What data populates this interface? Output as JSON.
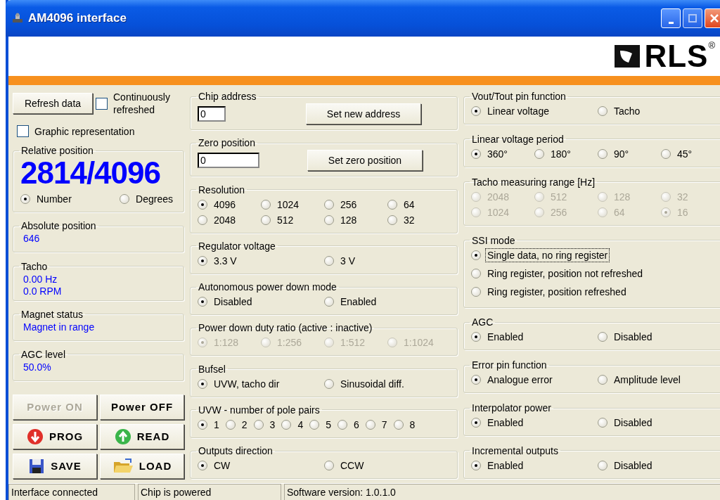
{
  "window": {
    "title": "AM4096 interface"
  },
  "logo": {
    "text": "RLS$^{®}$"
  },
  "left": {
    "refresh_button": "Refresh data",
    "continuous": {
      "label": "Continuously refreshed",
      "checked": false
    },
    "graphic": {
      "label": "Graphic representation",
      "checked": false
    },
    "relative": {
      "title": "Relative position",
      "value": "2814/4096",
      "options": [
        {
          "label": "Number",
          "selected": true
        },
        {
          "label": "Degrees",
          "selected": false
        }
      ]
    },
    "info": [
      {
        "title": "Absolute position",
        "lines": [
          "646"
        ]
      },
      {
        "title": "Tacho",
        "lines": [
          "0.00 Hz",
          "0.0 RPM"
        ]
      },
      {
        "title": "Magnet status",
        "lines": [
          "Magnet in range"
        ]
      },
      {
        "title": "AGC level",
        "lines": [
          "50.0%"
        ]
      }
    ],
    "buttons": [
      {
        "label": "Power ON",
        "disabled": true
      },
      {
        "label": "Power OFF",
        "disabled": false
      },
      {
        "label": "PROG",
        "disabled": false
      },
      {
        "label": "READ",
        "disabled": false
      },
      {
        "label": "SAVE",
        "disabled": false
      },
      {
        "label": "LOAD",
        "disabled": false
      }
    ]
  },
  "middle": [
    {
      "kind": "field",
      "title": "Chip address",
      "value": "0",
      "button": "Set new address",
      "disabled": false
    },
    {
      "kind": "field",
      "title": "Zero position",
      "value": "0",
      "button": "Set zero position",
      "disabled": false
    },
    {
      "kind": "radio-grid",
      "title": "Resolution",
      "disabled": false,
      "options": [
        {
          "label": "4096",
          "selected": true
        },
        {
          "label": "1024",
          "selected": false
        },
        {
          "label": "256",
          "selected": false
        },
        {
          "label": "64",
          "selected": false
        },
        {
          "label": "2048",
          "selected": false
        },
        {
          "label": "512",
          "selected": false
        },
        {
          "label": "128",
          "selected": false
        },
        {
          "label": "32",
          "selected": false
        }
      ]
    },
    {
      "kind": "radio-pair",
      "title": "Regulator voltage",
      "disabled": false,
      "options": [
        {
          "label": "3.3 V",
          "selected": true
        },
        {
          "label": "3 V",
          "selected": false
        }
      ]
    },
    {
      "kind": "radio-pair",
      "title": "Autonomous power down mode",
      "disabled": false,
      "options": [
        {
          "label": "Disabled",
          "selected": true
        },
        {
          "label": "Enabled",
          "selected": false
        }
      ]
    },
    {
      "kind": "radio-grid",
      "title": "Power down duty ratio (active : inactive)",
      "disabled": true,
      "options": [
        {
          "label": "1:128",
          "selected": true
        },
        {
          "label": "1:256",
          "selected": false
        },
        {
          "label": "1:512",
          "selected": false
        },
        {
          "label": "1:1024",
          "selected": false
        }
      ]
    },
    {
      "kind": "radio-pair",
      "title": "Bufsel",
      "disabled": false,
      "options": [
        {
          "label": "UVW, tacho dir",
          "selected": true
        },
        {
          "label": "Sinusoidal diff.",
          "selected": false
        }
      ]
    },
    {
      "kind": "radio-row",
      "title": "UVW - number of pole pairs",
      "disabled": false,
      "options": [
        {
          "label": "1",
          "selected": true
        },
        {
          "label": "2",
          "selected": false
        },
        {
          "label": "3",
          "selected": false
        },
        {
          "label": "4",
          "selected": false
        },
        {
          "label": "5",
          "selected": false
        },
        {
          "label": "6",
          "selected": false
        },
        {
          "label": "7",
          "selected": false
        },
        {
          "label": "8",
          "selected": false
        }
      ]
    },
    {
      "kind": "radio-pair",
      "title": "Outputs direction",
      "disabled": false,
      "options": [
        {
          "label": "CW",
          "selected": true
        },
        {
          "label": "CCW",
          "selected": false
        }
      ]
    }
  ],
  "right": [
    {
      "kind": "radio-pair",
      "title": "Vout/Tout pin function",
      "disabled": false,
      "options": [
        {
          "label": "Linear voltage",
          "selected": true
        },
        {
          "label": "Tacho",
          "selected": false
        }
      ]
    },
    {
      "kind": "radio-grid",
      "title": "Linear voltage period",
      "disabled": false,
      "options": [
        {
          "label": "360°",
          "selected": true
        },
        {
          "label": "180°",
          "selected": false
        },
        {
          "label": "90°",
          "selected": false
        },
        {
          "label": "45°",
          "selected": false
        }
      ]
    },
    {
      "kind": "radio-grid",
      "title": "Tacho measuring range [Hz]",
      "disabled": true,
      "options": [
        {
          "label": "2048",
          "selected": false
        },
        {
          "label": "512",
          "selected": false
        },
        {
          "label": "128",
          "selected": false
        },
        {
          "label": "32",
          "selected": false
        },
        {
          "label": "1024",
          "selected": false
        },
        {
          "label": "256",
          "selected": false
        },
        {
          "label": "64",
          "selected": false
        },
        {
          "label": "16",
          "selected": true
        }
      ]
    },
    {
      "kind": "radio-list",
      "title": "SSI mode",
      "disabled": false,
      "options": [
        {
          "label": "Single data, no ring register",
          "selected": true,
          "focused": true
        },
        {
          "label": "Ring register, position not refreshed",
          "selected": false,
          "focused": false
        },
        {
          "label": "Ring register, position refreshed",
          "selected": false,
          "focused": false
        }
      ]
    },
    {
      "kind": "radio-pair",
      "title": "AGC",
      "disabled": false,
      "options": [
        {
          "label": "Enabled",
          "selected": true
        },
        {
          "label": "Disabled",
          "selected": false
        }
      ]
    },
    {
      "kind": "radio-pair",
      "title": "Error pin function",
      "disabled": false,
      "options": [
        {
          "label": "Analogue error",
          "selected": true
        },
        {
          "label": "Amplitude level",
          "selected": false
        }
      ]
    },
    {
      "kind": "radio-pair",
      "title": "Interpolator power",
      "disabled": false,
      "options": [
        {
          "label": "Enabled",
          "selected": true
        },
        {
          "label": "Disabled",
          "selected": false
        }
      ]
    },
    {
      "kind": "radio-pair",
      "title": "Incremental outputs",
      "disabled": false,
      "options": [
        {
          "label": "Enabled",
          "selected": true
        },
        {
          "label": "Disabled",
          "selected": false
        }
      ]
    }
  ],
  "status_bar": [
    "Interface connected",
    "Chip is powered",
    "Software version: 1.0.1.0"
  ]
}
